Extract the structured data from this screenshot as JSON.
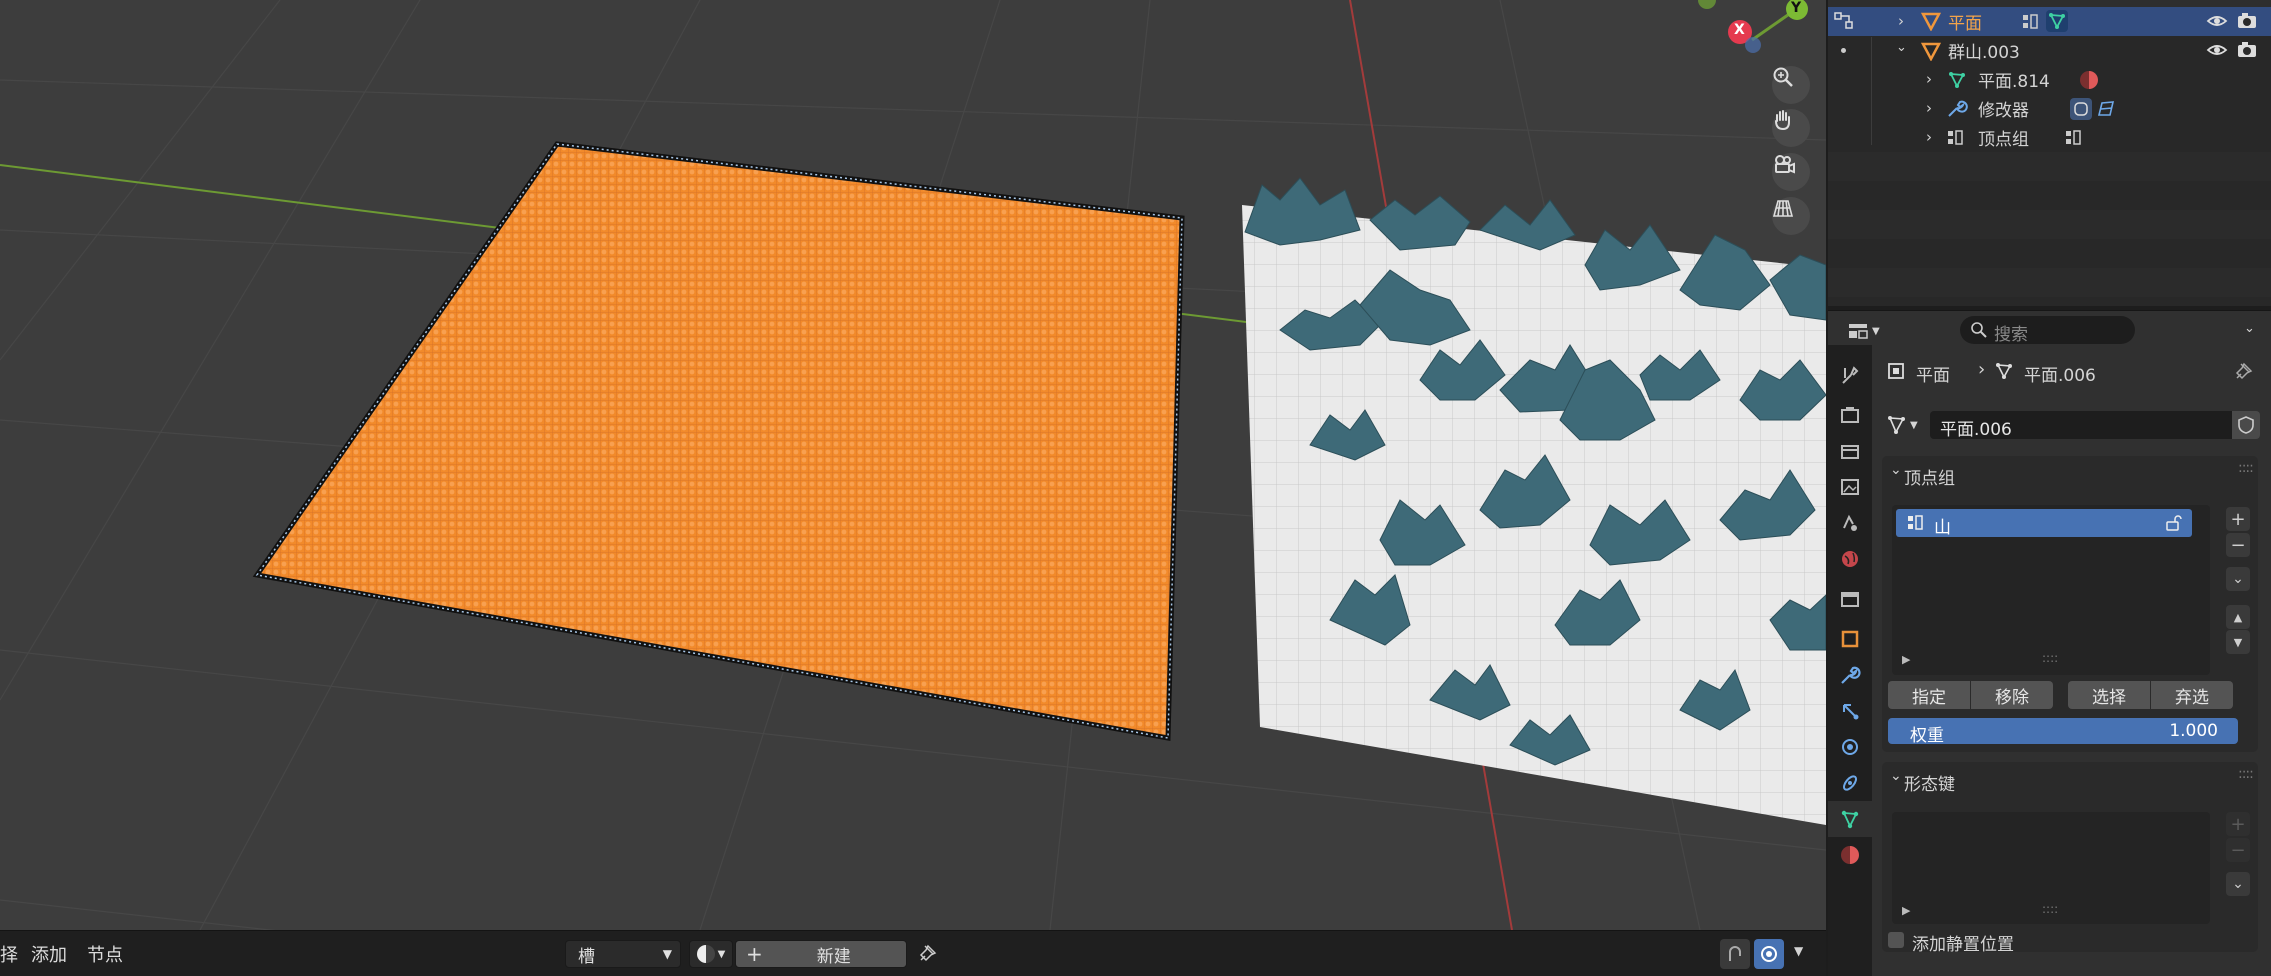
{
  "viewport": {
    "gizmo": {
      "x_label": "X",
      "y_label": "Y"
    }
  },
  "bottom_bar": {
    "menu": [
      "择",
      "添加",
      "节点"
    ],
    "slot_dropdown": "槽",
    "new_button": "新建"
  },
  "outliner": {
    "rows": [
      {
        "label": "平面",
        "selected": true
      },
      {
        "label": "群山.003"
      },
      {
        "label": "平面.814"
      },
      {
        "label": "修改器"
      },
      {
        "label": "顶点组"
      }
    ]
  },
  "properties": {
    "search_placeholder": "搜索",
    "breadcrumb": {
      "object": "平面",
      "mesh": "平面.006"
    },
    "mesh_name": "平面.006",
    "vertex_groups": {
      "title": "顶点组",
      "items": [
        "山"
      ],
      "assign": "指定",
      "remove": "移除",
      "select": "选择",
      "deselect": "弃选",
      "weight_label": "权重",
      "weight_value": "1.000"
    },
    "shape_keys": {
      "title": "形态键",
      "add_rest_position": "添加静置位置"
    }
  },
  "colors": {
    "accent_blue": "#4772b3",
    "selection_orange": "#f28a2a",
    "mountain_teal": "#3e6a78"
  }
}
